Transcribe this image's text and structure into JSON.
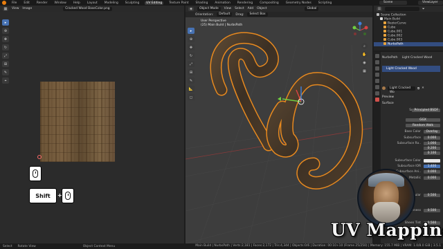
{
  "topbar": {
    "menus": [
      "File",
      "Edit",
      "Render",
      "Window",
      "Help"
    ],
    "tabs": [
      "Layout",
      "Modeling",
      "Sculpting",
      "UV Editing",
      "Texture Paint",
      "Shading",
      "Animation",
      "Rendering",
      "Compositing",
      "Geometry Nodes",
      "Scripting"
    ],
    "active_tab_index": 3,
    "scene": "Scene",
    "view_layer": "ViewLayer"
  },
  "image_editor": {
    "menus": [
      "View",
      "Image"
    ],
    "image_name": "Cracked Wood BaseColor.png",
    "tools": [
      "cursor-select",
      "cursor",
      "move",
      "rotate",
      "scale",
      "transform",
      "annotate",
      "sample"
    ]
  },
  "overlay_keys": {
    "shift_label": "Shift",
    "plus": "+"
  },
  "viewport": {
    "mode": "Object Mode",
    "menus": [
      "View",
      "Select",
      "Add",
      "Object"
    ],
    "orientation_label": "Orientation:",
    "orientation_value": "Default",
    "drag_label": "Drag:",
    "drag_value": "Select Box",
    "transform": "Global",
    "info_line1": "User Perspective",
    "info_line2": "(25) Main Build | NurbsPath"
  },
  "outliner": {
    "items": [
      {
        "label": "Scene Collection",
        "indent": 0,
        "selected": false
      },
      {
        "label": "Main Build",
        "indent": 1,
        "selected": false
      },
      {
        "label": "BezierCurve",
        "indent": 2,
        "selected": false
      },
      {
        "label": "Cube",
        "indent": 2,
        "selected": false
      },
      {
        "label": "Cube.001",
        "indent": 2,
        "selected": false
      },
      {
        "label": "Cube.002",
        "indent": 2,
        "selected": false
      },
      {
        "label": "Cube.003",
        "indent": 2,
        "selected": false
      },
      {
        "label": "NurbsPath",
        "indent": 2,
        "selected": true
      }
    ]
  },
  "properties": {
    "object": "NurbsPath",
    "material_tab": "Light Cracked Wood",
    "material_slot": "Light Cracked Wood",
    "material_field": "Light Cracked Wo",
    "preview": "Preview",
    "surface_section": "Surface",
    "surface_label": "Surface",
    "surface_value": "Principled BSDF",
    "distribution": "GGX",
    "subsurface_method": "Random Walk",
    "rows": [
      {
        "label": "Base Color",
        "value": "Overlay"
      },
      {
        "label": "Subsurface",
        "value": "0.000"
      },
      {
        "label": "Subsurface Ra..",
        "value": "1.000"
      },
      {
        "label": "",
        "value": "0.200"
      },
      {
        "label": "",
        "value": "0.100"
      },
      {
        "label": "Subsurface Color",
        "value": ""
      },
      {
        "label": "Subsurface IOR",
        "value": "1.400"
      },
      {
        "label": "Subsurface Ani..",
        "value": "0.000"
      },
      {
        "label": "Metallic",
        "value": "0.000"
      },
      {
        "label": "Specular",
        "value": "0.500"
      },
      {
        "label": "Roughness",
        "value": "0.500"
      },
      {
        "label": "Sheen Tint",
        "value": "0.500"
      }
    ]
  },
  "status_bar": {
    "left": [
      "Select",
      "Rotate View",
      "Object Context Menu"
    ],
    "right": "Main Build | NurbsPath | Verts:2,181 | Faces:2,172 | Tris:4,344 | Objects:0/6 | Duration: 00:10+10 (Frame 25/250) | Memory: 155.7 MiB | VRAM: 1.0/8.0 GiB | 3.5.1"
  },
  "branding": {
    "title": "UV Mapping"
  },
  "colors": {
    "accent": "#4772b3",
    "selection": "#334d80",
    "object_outline": "#e8891e",
    "blender_orange": "#e87d0d"
  }
}
